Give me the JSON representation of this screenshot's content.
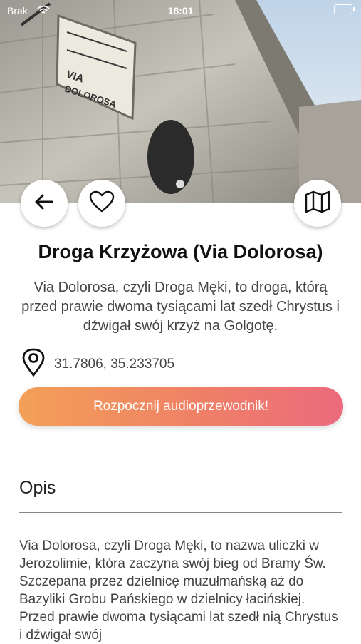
{
  "status_bar": {
    "carrier": "Brak",
    "time": "18:01"
  },
  "place": {
    "title": "Droga Krzyżowa (Via Dolorosa)",
    "subtitle": "Via Dolorosa, czyli Droga Męki, to droga, którą przed prawie dwoma tysiącami lat szedł Chrystus i dźwigał swój krzyż na Golgotę.",
    "coordinates": "31.7806, 35.233705"
  },
  "hero_sign": {
    "line1": "VIA",
    "line2": "DOLOROSA"
  },
  "actions": {
    "start_audio_guide": "Rozpocznij audioprzewodnik!"
  },
  "description": {
    "heading": "Opis",
    "text": "Via Dolorosa, czyli Droga Męki, to nazwa uliczki w Jerozolimie, która zaczyna swój bieg od Bramy Św. Szczepana przez dzielnicę muzułmańską aż do Bazyliki Grobu Pańskiego w dzielnicy łacińskiej. Przed prawie dwoma tysiącami lat szedł nią Chrystus i dźwigał swój"
  },
  "colors": {
    "cta_start": "#f3a058",
    "cta_end": "#eb6a7d"
  },
  "icons": [
    "back-arrow-icon",
    "heart-icon",
    "map-icon",
    "location-pin-icon",
    "wifi-icon",
    "battery-icon"
  ]
}
